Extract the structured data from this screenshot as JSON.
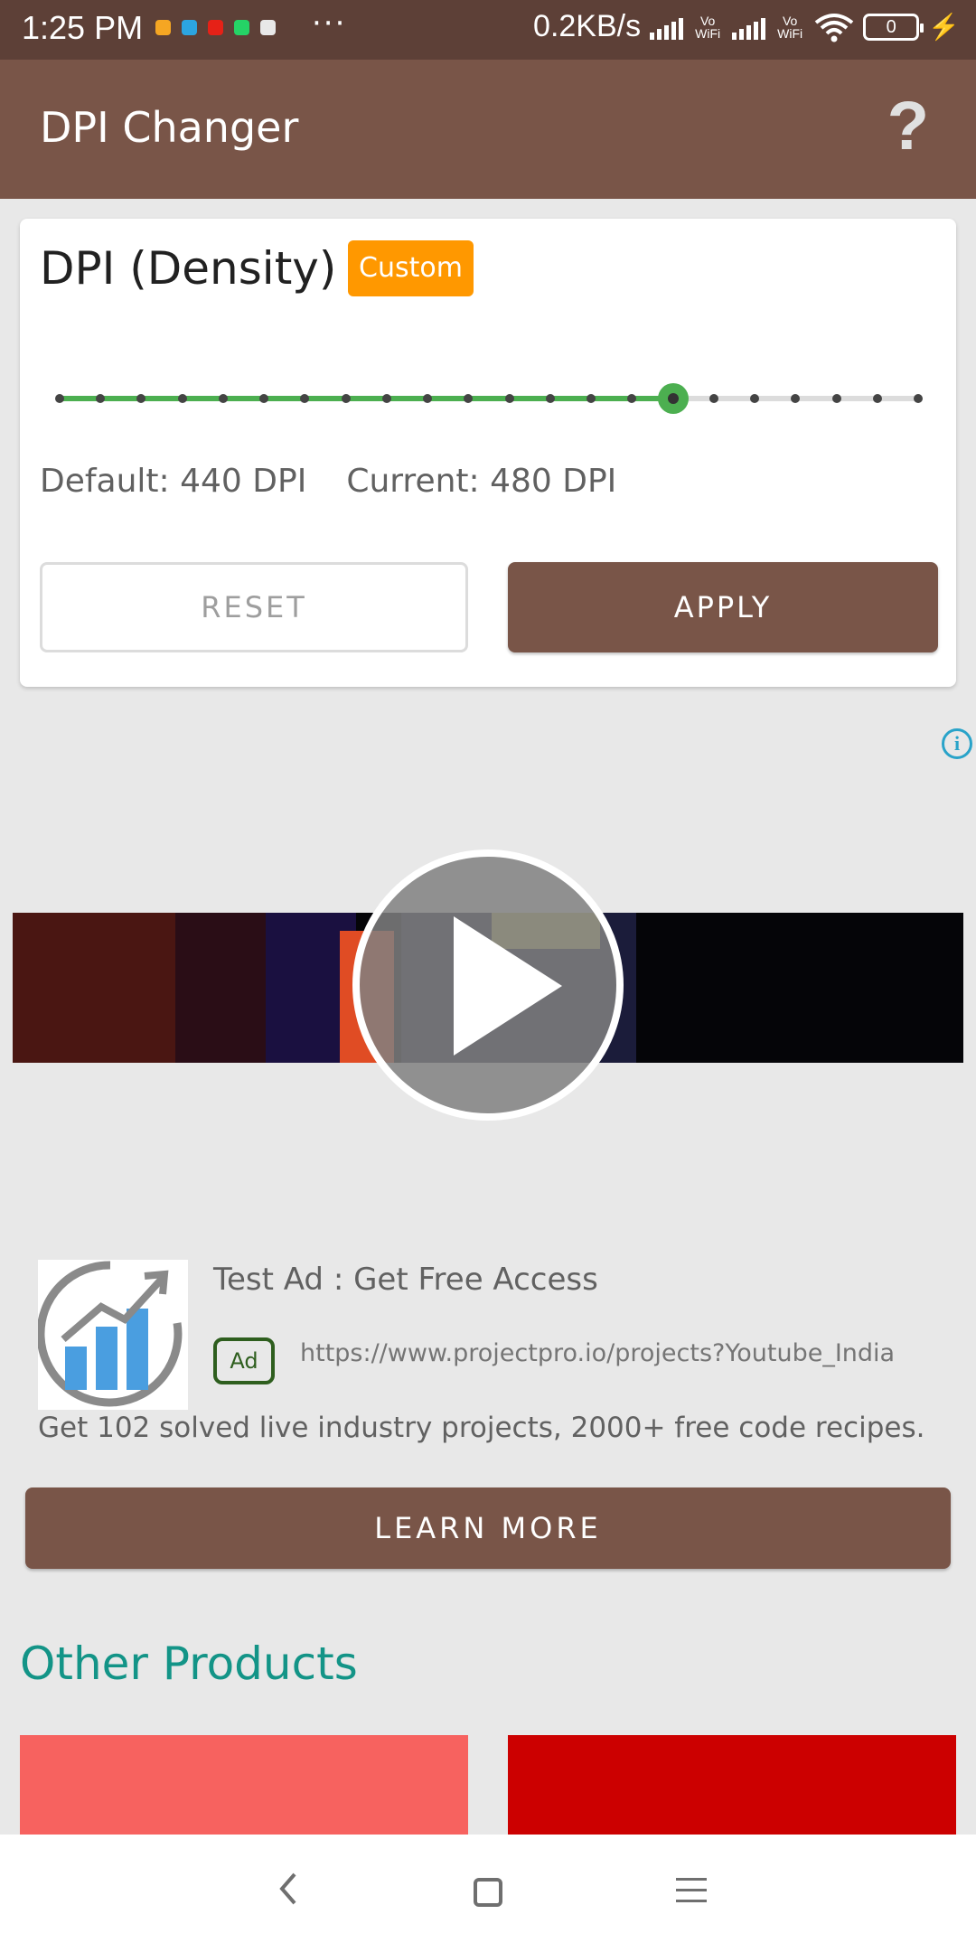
{
  "status_bar": {
    "time": "1:25 PM",
    "dots": "···",
    "net_speed": "0.2KB/s",
    "vowifi_label_1": "Vo\nWiFi",
    "vowifi_label_2": "Vo\nWiFi",
    "battery_level": "0",
    "notification_icons": [
      "notes-icon",
      "telegram-icon",
      "youtube-icon",
      "whatsapp-icon",
      "slack-icon"
    ],
    "notification_colors": [
      "#f5a623",
      "#2ca5e0",
      "#e62117",
      "#25d366",
      "#e8e8e8"
    ]
  },
  "app_bar": {
    "title": "DPI Changer",
    "help_glyph": "?"
  },
  "dpi_card": {
    "title": "DPI (Density)",
    "mode_badge": "Custom",
    "slider": {
      "tick_count": 22,
      "selected_index": 15
    },
    "default_label": "Default: 440 DPI",
    "current_label": "Current: 480 DPI",
    "reset_label": "RESET",
    "apply_label": "APPLY"
  },
  "ad": {
    "info_glyph": "i",
    "title": "Test Ad : Get Free Access",
    "badge": "Ad",
    "url": "https://www.projectpro.io/projects?Youtube_India",
    "description": "Get 102 solved live industry projects, 2000+ free code recipes.",
    "cta_label": "LEARN MORE"
  },
  "other_products": {
    "title": "Other Products",
    "colors": [
      "#f7625f",
      "#cc0000"
    ]
  },
  "colors": {
    "primary": "#795548",
    "status_bar": "#5d4037",
    "accent_badge": "#ff9800",
    "slider_active": "#4caf50",
    "section_title": "#139487"
  }
}
